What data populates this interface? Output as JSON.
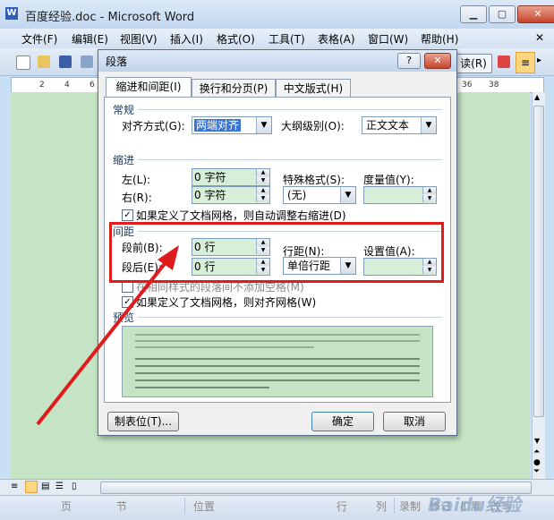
{
  "window": {
    "title": "百度经验.doc - Microsoft Word",
    "app_icon": "W"
  },
  "menu": [
    "文件(F)",
    "编辑(E)",
    "视图(V)",
    "插入(I)",
    "格式(O)",
    "工具(T)",
    "表格(A)",
    "窗口(W)",
    "帮助(H)"
  ],
  "toolbar": {
    "read_label": "读(R)"
  },
  "ruler": {
    "left_ticks": [
      "2",
      "4",
      "6"
    ],
    "right_ticks": [
      "36",
      "38"
    ]
  },
  "dialog": {
    "title": "段落",
    "help": "?",
    "tabs": [
      "缩进和间距(I)",
      "换行和分页(P)",
      "中文版式(H)"
    ],
    "general": {
      "heading": "常规",
      "alignment_label": "对齐方式(G):",
      "alignment_value": "两端对齐",
      "outline_label": "大纲级别(O):",
      "outline_value": "正文文本"
    },
    "indent": {
      "heading": "缩进",
      "left_label": "左(L):",
      "left_value": "0 字符",
      "right_label": "右(R):",
      "right_value": "0 字符",
      "special_label": "特殊格式(S):",
      "special_value": "(无)",
      "by_label": "度量值(Y):",
      "by_value": "",
      "auto_adjust_label": "如果定义了文档网格，则自动调整右缩进(D)",
      "auto_adjust_checked": true
    },
    "spacing": {
      "heading": "间距",
      "before_label": "段前(B):",
      "before_value": "0 行",
      "after_label": "段后(E):",
      "after_value": "0 行",
      "line_label": "行距(N):",
      "line_value": "单倍行距",
      "at_label": "设置值(A):",
      "at_value": "",
      "no_space_label": "在相同样式的段落间不添加空格(M)",
      "no_space_checked": false,
      "snap_grid_label": "如果定义了文档网格，则对齐网格(W)",
      "snap_grid_checked": true
    },
    "preview": {
      "heading": "预览"
    },
    "buttons": {
      "tabs": "制表位(T)...",
      "ok": "确定",
      "cancel": "取消"
    }
  },
  "statusbar": [
    "页",
    "节",
    "位置",
    "行",
    "列",
    "录制",
    "修订",
    "扩展",
    "改写"
  ],
  "watermark": "Baidu经验",
  "colors": {
    "highlight_box": "#e01b1b",
    "arrow": "#e01b1b",
    "doc_bg": "#c5e4c5"
  }
}
